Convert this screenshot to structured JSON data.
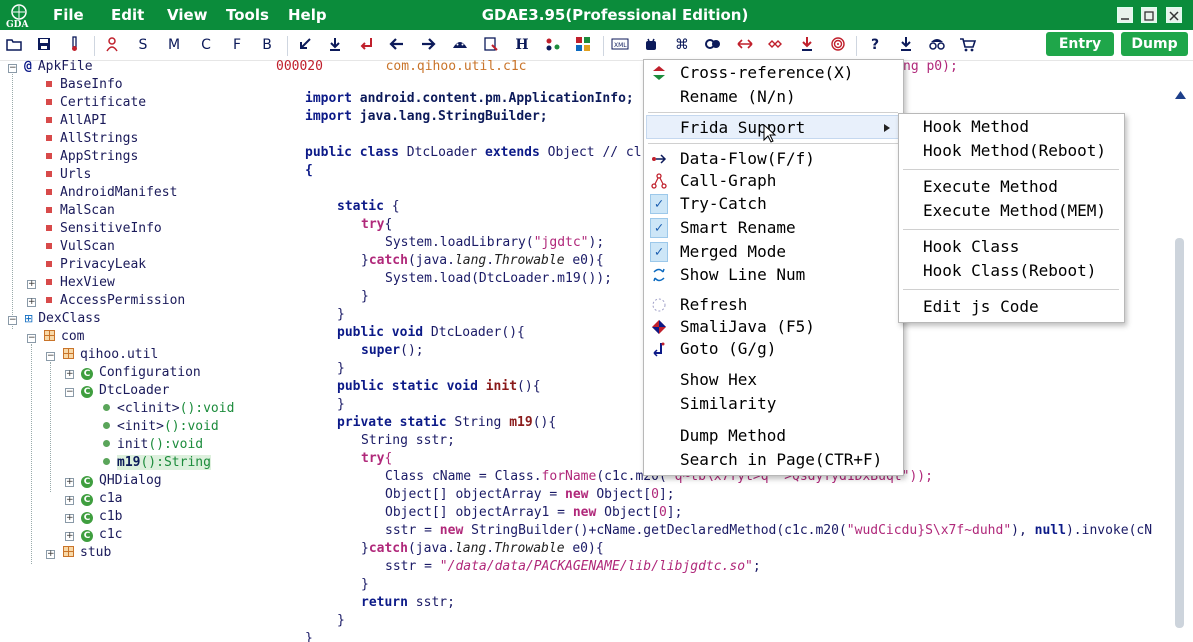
{
  "title_bar": {
    "menu": [
      "File",
      "Edit",
      "View",
      "Tools",
      "Help"
    ],
    "title": "GDAE3.95(Professional Edition)"
  },
  "toolbar": {
    "text_icons": [
      "S",
      "M",
      "C",
      "F",
      "B",
      "H"
    ],
    "entry_label": "Entry",
    "dump_label": "Dump"
  },
  "tree": {
    "apk_root": "ApkFile",
    "apk_items": [
      "BaseInfo",
      "Certificate",
      "AllAPI",
      "AllStrings",
      "AppStrings",
      "Urls",
      "AndroidManifest",
      "MalScan",
      "SensitiveInfo",
      "VulScan",
      "PrivacyLeak",
      "HexView",
      "AccessPermission"
    ],
    "dex_root": "DexClass",
    "com": "com",
    "qihoo": "qihoo.util",
    "configuration": "Configuration",
    "dtcloader": "DtcLoader",
    "methods": [
      {
        "name": "<clinit>",
        "sig": "():void"
      },
      {
        "name": "<init>",
        "sig": "():void"
      },
      {
        "name": "init",
        "sig": "():void"
      },
      {
        "name": "m19",
        "sig": "():String"
      }
    ],
    "classes_after": [
      "QHDialog",
      "c1a",
      "c1b",
      "c1c"
    ],
    "stub": "stub"
  },
  "code": {
    "header_offset": "000020",
    "header_class": "com.qihoo.util.c1c",
    "header_tail": "ng p0);",
    "lines": {
      "l1a": "import",
      "l1b": " android.content.pm.ApplicationInfo;",
      "l2a": "import",
      "l2b": " java.lang.StringBuilder;",
      "l3a": "public",
      "l3b": " ",
      "l3c": "class",
      "l3d": " DtcLoader ",
      "l3e": "extends",
      "l3f": " Object // cl",
      "l4": "{",
      "l5a": "static",
      "l5b": " {",
      "l6a": "try",
      "l6b": "{",
      "l7a": "System.loadLibrary(",
      "l7b": "\"jgdtc\"",
      "l7c": ");",
      "l8a": "}",
      "l8b": "catch",
      "l8c": "(java.",
      "l8d": "lang",
      "l8e": ".",
      "l8f": "Throwable",
      "l8g": " e0){",
      "l9": "System.load(DtcLoader.m19());",
      "l10": "}",
      "l11": "}",
      "l12a": "public",
      "l12b": " ",
      "l12c": "void",
      "l12d": " DtcLoader(){",
      "l13a": "super",
      "l13b": "();",
      "l14": "}",
      "l15a": "public",
      "l15b": " ",
      "l15c": "static",
      "l15d": " ",
      "l15e": "void",
      "l15f": " ",
      "l15g": "init",
      "l15h": "(){",
      "l16": "}",
      "l17a": "private",
      "l17b": " ",
      "l17c": "static",
      "l17d": " String ",
      "l17e": "m19",
      "l17f": "(){",
      "l18": "String sstr;",
      "l19a": "try",
      "l19b": "{",
      "l20a": "Class cName = Class.",
      "l20b": "forName",
      "l20c": "(c1c.m20(",
      "l20d": "\"q~tb\\x7fyt>q  >Qsdyfyd1DxBuqt\"",
      "l20e": "));",
      "l21a": "Object[] objectArray = ",
      "l21b": "new",
      "l21c": " Object[",
      "l21d": "0",
      "l21e": "];",
      "l22a": "Object[] objectArray1 = ",
      "l22b": "new",
      "l22c": " Object[",
      "l22d": "0",
      "l22e": "];",
      "l23a": "sstr = ",
      "l23b": "new",
      "l23c": " StringBuilder()+cName.getDeclaredMethod(c1c.m20(",
      "l23d": "\"wudCicdu}S\\x7f~duhd\"",
      "l23e": "), ",
      "l23f": "null",
      "l23g": ").invoke(cN",
      "l24a": "}",
      "l24b": "catch",
      "l24c": "(java.",
      "l24d": "lang",
      "l24e": ".",
      "l24f": "Throwable",
      "l24g": " e0){",
      "l25a": "sstr = ",
      "l25b": "\"/data/data/PACKAGENAME/lib/libjgdtc.so\"",
      "l25c": ";",
      "l26": "}",
      "l27a": "return",
      "l27b": " sstr;",
      "l28": "}",
      "l29": "}"
    }
  },
  "context_menu": {
    "items": {
      "xref": "Cross-reference(X)",
      "rename": "Rename (N/n)",
      "frida": "Frida Support",
      "dataflow": "Data-Flow(F/f)",
      "callgraph": "Call-Graph",
      "trycatch": "Try-Catch",
      "smartrename": "Smart Rename",
      "merged": "Merged Mode",
      "linenum": "Show Line Num",
      "refresh": "Refresh",
      "smalijava": "SmaliJava (F5)",
      "goto": "Goto (G/g)",
      "showhex": "Show Hex",
      "similarity": "Similarity",
      "dumpmethod": "Dump Method",
      "search": "Search in Page(CTR+F)"
    }
  },
  "frida_submenu": {
    "items": [
      "Hook Method",
      "Hook Method(Reboot)",
      "Execute Method",
      "Execute Method(MEM)",
      "Hook Class",
      "Hook Class(Reboot)",
      "Edit js Code"
    ]
  },
  "colors": {
    "title_green": "#0b8c3b",
    "button_green": "#1fa64a",
    "keyword": "#0c1a88",
    "string": "#b0287a"
  }
}
